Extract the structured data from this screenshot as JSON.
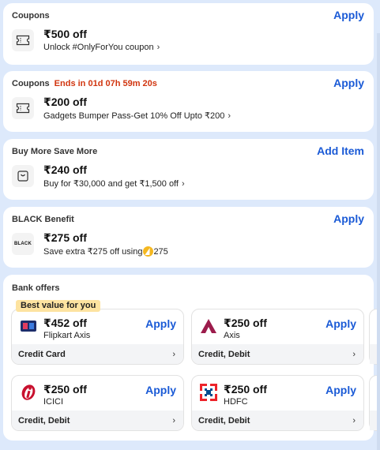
{
  "offers": [
    {
      "heading": "Coupons",
      "timer": "",
      "action": "Apply",
      "icon": "coupon-ticket-icon",
      "amount": "₹500 off",
      "description": "Unlock #OnlyForYou coupon"
    },
    {
      "heading": "Coupons",
      "timer": "Ends in 01d 07h 59m 20s",
      "action": "Apply",
      "icon": "coupon-ticket-icon",
      "amount": "₹200 off",
      "description": "Gadgets Bumper Pass-Get 10% Off Upto ₹200"
    },
    {
      "heading": "Buy More Save More",
      "timer": "",
      "action": "Add Item",
      "icon": "shopping-bag-icon",
      "amount": "₹240 off",
      "description": "Buy for ₹30,000 and get ₹1,500 off"
    },
    {
      "heading": "BLACK Benefit",
      "timer": "",
      "action": "Apply",
      "icon": "black-logo",
      "logo_text": "BLACK",
      "amount": "₹275 off",
      "description_prefix": "Save extra ₹275 off using",
      "supercoin_value": "275"
    }
  ],
  "bank_offers": {
    "heading": "Bank offers",
    "badge": "Best value for you",
    "cards": [
      {
        "amount": "₹452 off",
        "bank": "Flipkart Axis",
        "action": "Apply",
        "type": "Credit Card",
        "logo": "flipkart-axis-card-icon"
      },
      {
        "amount": "₹250 off",
        "bank": "Axis",
        "action": "Apply",
        "type": "Credit, Debit",
        "logo": "axis-bank-logo-icon"
      },
      {
        "amount": "₹250 off",
        "bank": "ICICI",
        "action": "Apply",
        "type": "Credit, Debit",
        "logo": "icici-logo-icon"
      },
      {
        "amount": "₹250 off",
        "bank": "HDFC",
        "action": "Apply",
        "type": "Credit, Debit",
        "logo": "hdfc-logo-icon"
      }
    ]
  },
  "colors": {
    "page_bg": "#dde9fb",
    "accent": "#1a5ad6",
    "timer": "#d1350f",
    "badge": "#fde3a0"
  }
}
